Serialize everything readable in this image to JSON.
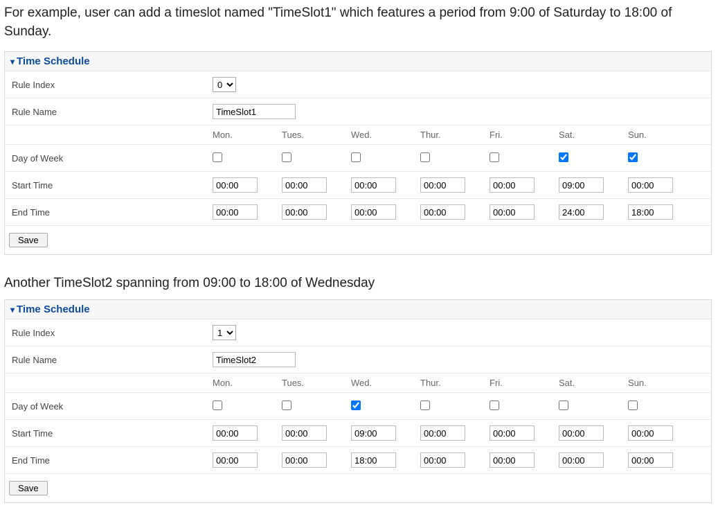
{
  "intro_text": "For example, user can add a timeslot named \"TimeSlot1\" which features a period from 9:00 of Saturday to 18:00 of Sunday.",
  "sub_text": "Another TimeSlot2 spanning from 09:00 to 18:00 of Wednesday",
  "labels": {
    "panel_title": "Time Schedule",
    "rule_index": "Rule Index",
    "rule_name": "Rule Name",
    "day_of_week": "Day of Week",
    "start_time": "Start Time",
    "end_time": "End Time",
    "save": "Save"
  },
  "days": [
    "Mon.",
    "Tues.",
    "Wed.",
    "Thur.",
    "Fri.",
    "Sat.",
    "Sun."
  ],
  "slot1": {
    "rule_index": "0",
    "rule_name": "TimeSlot1",
    "day_checked": [
      false,
      false,
      false,
      false,
      false,
      true,
      true
    ],
    "start": [
      "00:00",
      "00:00",
      "00:00",
      "00:00",
      "00:00",
      "09:00",
      "00:00"
    ],
    "end": [
      "00:00",
      "00:00",
      "00:00",
      "00:00",
      "00:00",
      "24:00",
      "18:00"
    ]
  },
  "slot2": {
    "rule_index": "1",
    "rule_name": "TimeSlot2",
    "day_checked": [
      false,
      false,
      true,
      false,
      false,
      false,
      false
    ],
    "start": [
      "00:00",
      "00:00",
      "09:00",
      "00:00",
      "00:00",
      "00:00",
      "00:00"
    ],
    "end": [
      "00:00",
      "00:00",
      "18:00",
      "00:00",
      "00:00",
      "00:00",
      "00:00"
    ]
  }
}
